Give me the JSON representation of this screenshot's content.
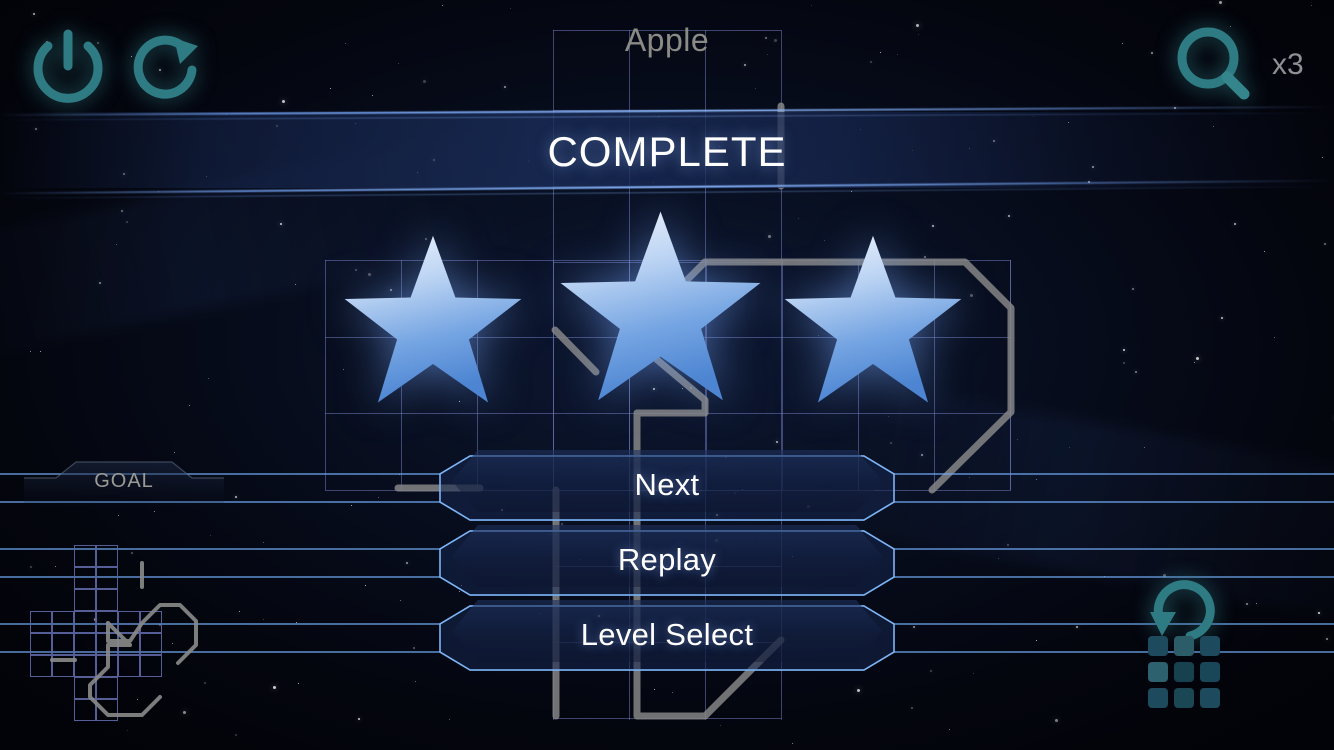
{
  "header": {
    "level_name": "Apple",
    "status": "COMPLETE",
    "power_icon": "power-icon",
    "restart_icon": "restart-icon",
    "hint_icon": "magnifier-icon",
    "hint_count": "x3"
  },
  "rating": {
    "stars_earned": 3,
    "stars_total": 3,
    "star_icon": "star-icon"
  },
  "menu": {
    "buttons": [
      {
        "label": "Next",
        "name": "next-button"
      },
      {
        "label": "Replay",
        "name": "replay-button"
      },
      {
        "label": "Level Select",
        "name": "level-select-button"
      }
    ]
  },
  "goal": {
    "label": "GOAL",
    "preview_name": "goal-board-preview"
  },
  "footer": {
    "undo_icon": "undo-icon",
    "level_grid_icon": "level-grid-icon"
  },
  "colors": {
    "background": "#04060f",
    "accent_teal": "#2e7a82",
    "grid_line": "#6d77b8",
    "banner_edge": "#7cb0ff",
    "star_light": "#dbe9fb",
    "star_mid": "#6fa2e0",
    "star_deep": "#3f79c9",
    "path_gray": "#8a8a8a",
    "text_muted": "#8b8b86",
    "text_bright": "#ffffff"
  }
}
